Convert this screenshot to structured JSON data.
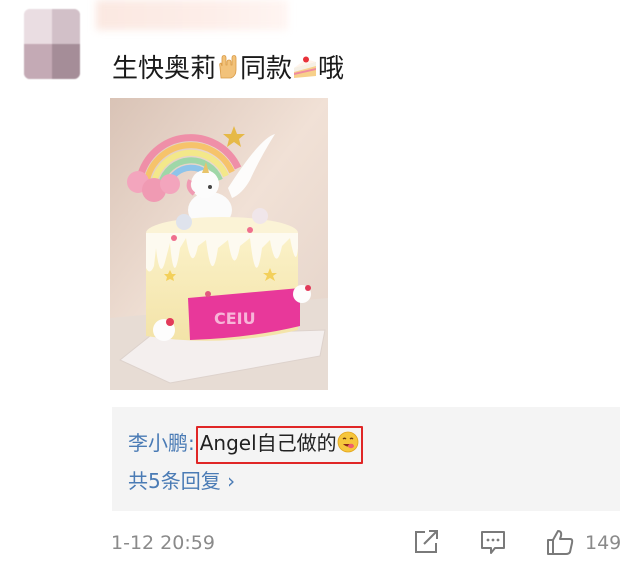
{
  "comment": {
    "text_before": "生快奥莉",
    "emoji1": "love-you-gesture",
    "text_middle": "同款",
    "emoji2": "cake-slice",
    "text_after": "哦"
  },
  "reply": {
    "user": "李小鹏",
    "colon": ":",
    "text": "Angel自己做的",
    "emoji": "yum-face",
    "more": "共5条回复 ›"
  },
  "meta": {
    "time": "1-12 20:59",
    "like_count": "149"
  },
  "colors": {
    "link_blue": "#4a7bb5",
    "highlight_red": "#e02626",
    "meta_gray": "#8a8a8a",
    "reply_bg": "#f4f4f4"
  }
}
